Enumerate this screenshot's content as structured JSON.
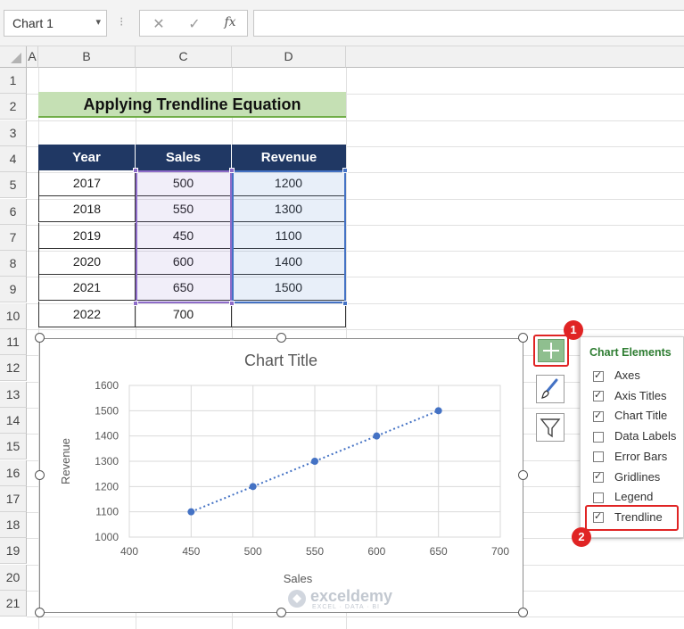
{
  "formula_bar": {
    "name_box": "Chart 1",
    "name_box_arrow": "▾",
    "separator": "⁝",
    "cancel_icon": "✕",
    "enter_icon": "✓",
    "fx_label": "fx",
    "formula": ""
  },
  "columns": [
    "A",
    "B",
    "C",
    "D"
  ],
  "rows": [
    "1",
    "2",
    "3",
    "4",
    "5",
    "6",
    "7",
    "8",
    "9",
    "10",
    "11",
    "12",
    "13",
    "14",
    "15",
    "16",
    "17",
    "18",
    "19",
    "20",
    "21"
  ],
  "title_cell": "Applying Trendline Equation",
  "table": {
    "headers": [
      "Year",
      "Sales",
      "Revenue"
    ],
    "rows": [
      [
        "2017",
        "500",
        "1200"
      ],
      [
        "2018",
        "550",
        "1300"
      ],
      [
        "2019",
        "450",
        "1100"
      ],
      [
        "2020",
        "600",
        "1400"
      ],
      [
        "2021",
        "650",
        "1500"
      ],
      [
        "2022",
        "700",
        ""
      ]
    ]
  },
  "chart_data": {
    "type": "scatter",
    "title": "Chart Title",
    "xlabel": "Sales",
    "ylabel": "Revenue",
    "xlim": [
      400,
      700
    ],
    "ylim": [
      1000,
      1600
    ],
    "x_ticks": [
      "400",
      "450",
      "500",
      "550",
      "600",
      "650",
      "700"
    ],
    "y_ticks": [
      "1000",
      "1100",
      "1200",
      "1300",
      "1400",
      "1500",
      "1600"
    ],
    "x": [
      450,
      500,
      550,
      600,
      650
    ],
    "y": [
      1100,
      1200,
      1300,
      1400,
      1500
    ],
    "trendline": "linear",
    "grid": true,
    "marker_color": "#4472c4"
  },
  "chart_elements": {
    "title": "Chart Elements",
    "items": [
      {
        "label": "Axes",
        "checked": true
      },
      {
        "label": "Axis Titles",
        "checked": true
      },
      {
        "label": "Chart Title",
        "checked": true
      },
      {
        "label": "Data Labels",
        "checked": false
      },
      {
        "label": "Error Bars",
        "checked": false
      },
      {
        "label": "Gridlines",
        "checked": true
      },
      {
        "label": "Legend",
        "checked": false
      },
      {
        "label": "Trendline",
        "checked": true
      }
    ]
  },
  "badges": {
    "first": "1",
    "second": "2"
  },
  "watermark": {
    "name": "exceldemy",
    "tagline": "EXCEL · DATA · BI"
  },
  "icons": [
    "plus-icon",
    "brush-icon",
    "filter-icon",
    "check-icon",
    "cancel-icon",
    "function-icon"
  ]
}
